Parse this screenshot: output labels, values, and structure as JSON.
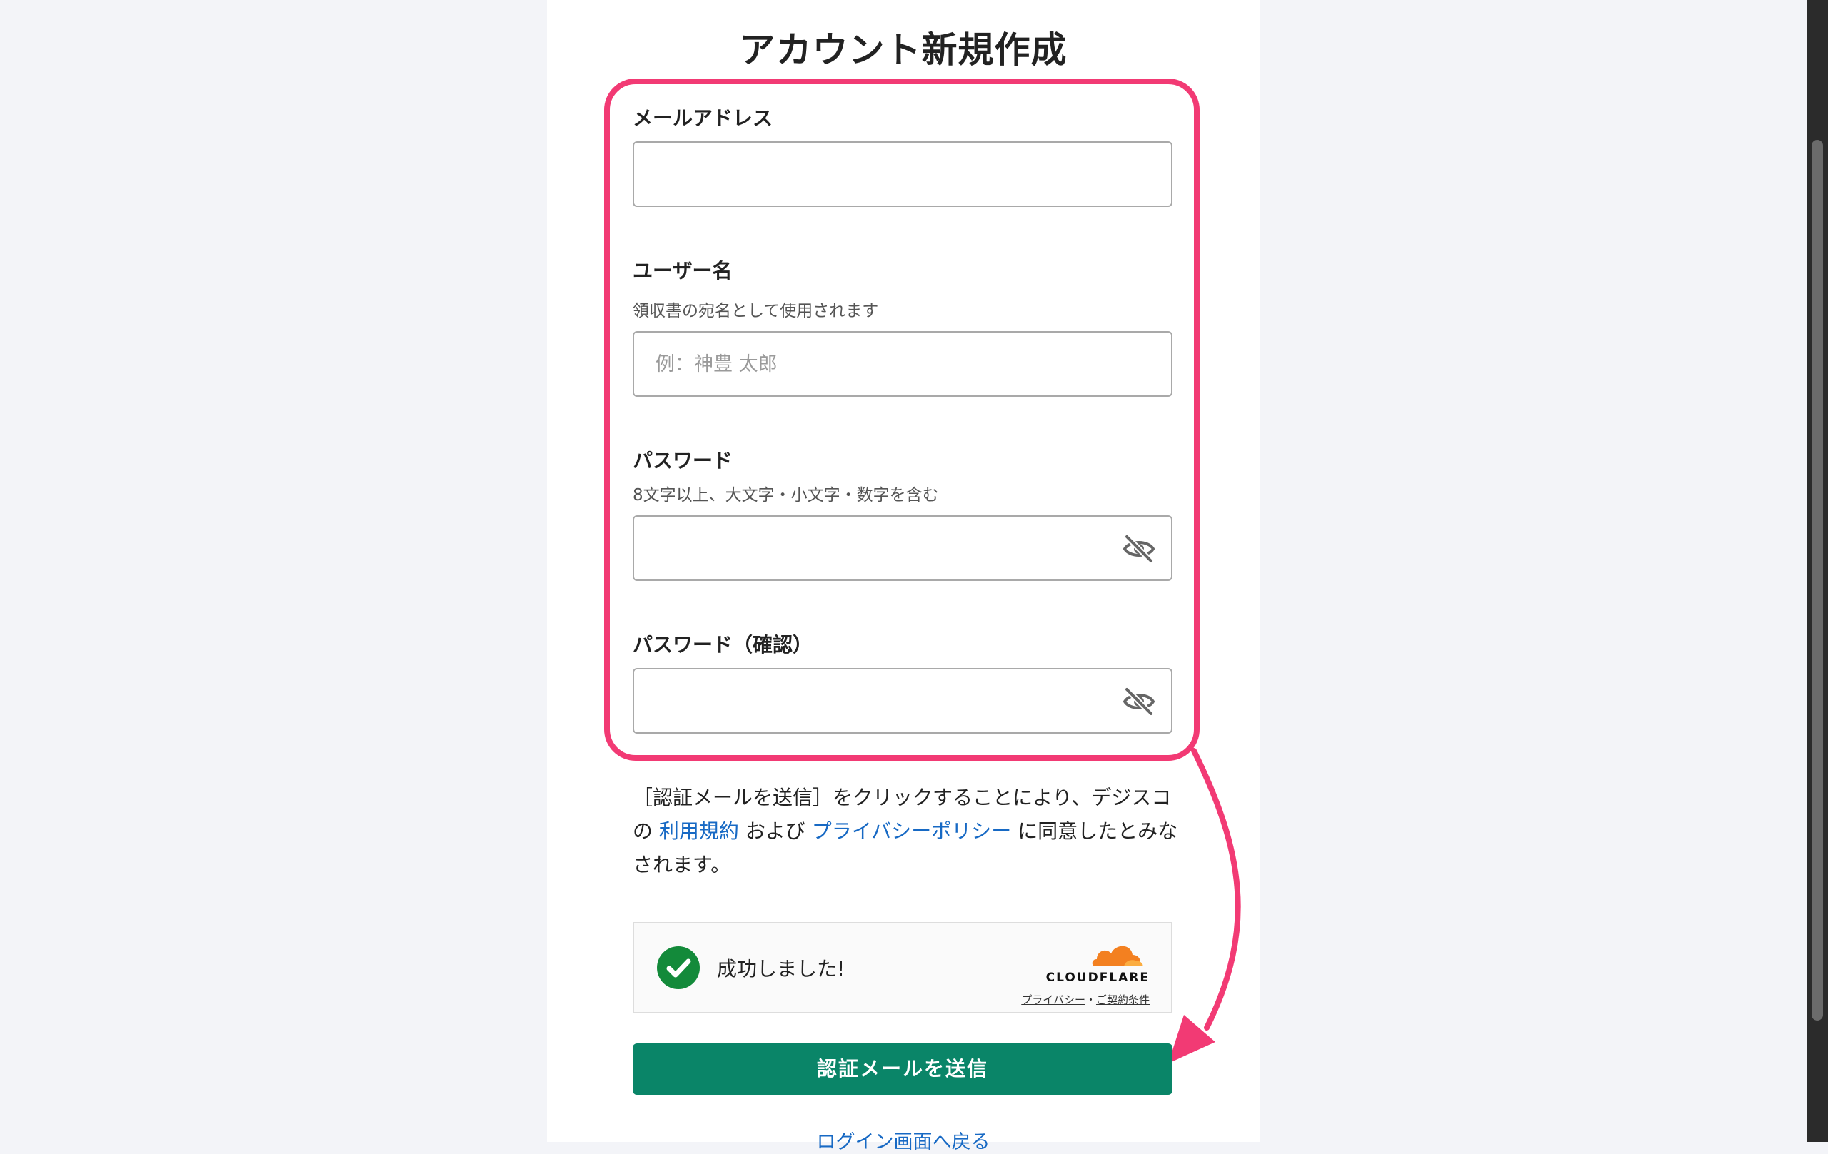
{
  "page": {
    "title": "アカウント新規作成"
  },
  "form": {
    "email": {
      "label": "メールアドレス",
      "value": "",
      "placeholder": ""
    },
    "username": {
      "label": "ユーザー名",
      "help": "領収書の宛名として使用されます",
      "value": "",
      "placeholder": "例：神豊 太郎"
    },
    "password": {
      "label": "パスワード",
      "help": "8文字以上、大文字・小文字・数字を含む",
      "value": "",
      "placeholder": ""
    },
    "password_confirm": {
      "label": "パスワード（確認）",
      "value": "",
      "placeholder": ""
    }
  },
  "terms": {
    "line_pre": "［認証メールを送信］をクリックすることにより、デジスコの",
    "terms_link": "利用規約",
    "and": "および",
    "privacy_link": "プライバシーポリシー",
    "line_post": "に同意したとみなされます。"
  },
  "captcha": {
    "status": "成功しました!",
    "brand": "CLOUDFLARE",
    "privacy": "プライバシー",
    "separator": "・",
    "terms": "ご契約条件"
  },
  "submit_label": "認証メールを送信",
  "back_link": "ログイン画面へ戻る",
  "colors": {
    "accent": "#0a8568",
    "highlight": "#f23a74",
    "link": "#1769c4",
    "success": "#138a3a",
    "cloudflare": "#f38020"
  },
  "icons": {
    "password_toggle": "eye-slash-icon",
    "captcha_status": "check-circle-icon",
    "brand": "cloudflare-cloud-icon"
  }
}
